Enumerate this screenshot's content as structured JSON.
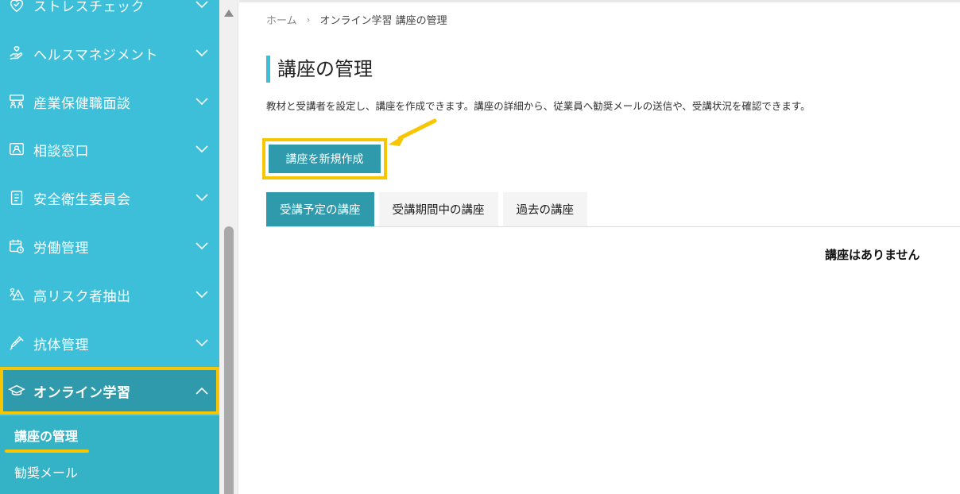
{
  "sidebar": {
    "items": [
      {
        "label": "ストレスチェック",
        "icon": "heart-check-icon",
        "expanded": false
      },
      {
        "label": "ヘルスマネジメント",
        "icon": "hand-heart-icon",
        "expanded": false
      },
      {
        "label": "産業保健職面談",
        "icon": "meeting-people-icon",
        "expanded": false
      },
      {
        "label": "相談窓口",
        "icon": "consultation-icon",
        "expanded": false
      },
      {
        "label": "安全衛生委員会",
        "icon": "document-clipboard-icon",
        "expanded": false
      },
      {
        "label": "労働管理",
        "icon": "calendar-clock-icon",
        "expanded": false
      },
      {
        "label": "高リスク者抽出",
        "icon": "warning-person-icon",
        "expanded": false
      },
      {
        "label": "抗体管理",
        "icon": "syringe-icon",
        "expanded": false
      },
      {
        "label": "オンライン学習",
        "icon": "graduation-cap-icon",
        "expanded": true
      }
    ],
    "submenu": [
      {
        "label": "講座の管理",
        "active": true
      },
      {
        "label": "勧奨メール",
        "active": false
      }
    ]
  },
  "breadcrumb": {
    "home": "ホーム",
    "separator": "›",
    "current": "オンライン学習 講座の管理"
  },
  "page": {
    "title": "講座の管理",
    "description": "教材と受講者を設定し、講座を作成できます。講座の詳細から、従業員へ勧奨メールの送信や、受講状況を確認できます。",
    "create_button": "講座を新規作成"
  },
  "tabs": [
    {
      "label": "受講予定の講座",
      "active": true
    },
    {
      "label": "受講期間中の講座",
      "active": false
    },
    {
      "label": "過去の講座",
      "active": false
    }
  ],
  "empty_message": "講座はありません",
  "colors": {
    "sidebar_bg": "#3dbfd9",
    "sidebar_active": "#2f9aab",
    "accent": "#2f9aab",
    "highlight": "#f7c600"
  }
}
